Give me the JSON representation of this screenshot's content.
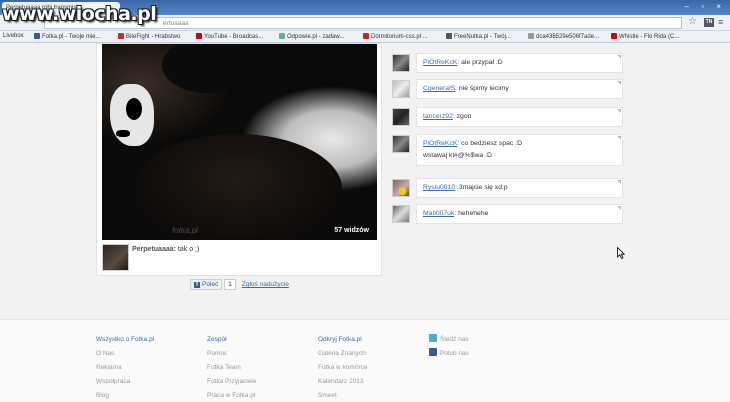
{
  "watermark": "www.wiocha.pl",
  "browser": {
    "tab_title": "Perpetuaaaa robi transmisj",
    "url_text": "ertuaaaa",
    "window_controls": "– ▫ ×",
    "ext_label": "TN",
    "bookmarks": [
      {
        "label": "Livebox",
        "icon_color": "#f60"
      },
      {
        "label": "Fotka.pl - Twoje mie...",
        "icon_color": "#3b5998"
      },
      {
        "label": "BiteFight - Hrabstwo",
        "icon_color": "#b33"
      },
      {
        "label": "YouTube - Broadcas...",
        "icon_color": "#d00"
      },
      {
        "label": "Odpowie.pl - zadaw...",
        "icon_color": "#6a9"
      },
      {
        "label": "Dormitorium-css.pl ...",
        "icon_color": "#c22"
      },
      {
        "label": "FreeNutka.pl - Twój...",
        "icon_color": "#555"
      },
      {
        "label": "dca438529e506f7ade...",
        "icon_color": "#999"
      },
      {
        "label": "Whistle - Flo Rida (C...",
        "icon_color": "#d00"
      }
    ]
  },
  "video": {
    "views": "57 widzów",
    "watermark": "fotka.pl"
  },
  "post": {
    "name": "Perpetuaaaa:",
    "text": "tak o ;)"
  },
  "share": {
    "fb_label": "Poleć",
    "count": "1",
    "report_label": "Zgłoś nadużycie"
  },
  "comments": [
    {
      "user": "PiOtReKcK",
      "text": "ale przypał :D",
      "line2": ""
    },
    {
      "user": "CgeneralS",
      "text": "nie śpimy lecimy",
      "line2": ""
    },
    {
      "user": "tancerz92",
      "text": "zgon",
      "line2": ""
    },
    {
      "user": "PiOtReKcK",
      "text": "co bedziesz spac :D",
      "line2": "wstawaj kl#@%$wa :D"
    },
    {
      "user": "Rysiu0810",
      "text": "3majcie się xd:p",
      "line2": ""
    },
    {
      "user": "Mati007uk",
      "text": "hehehehe",
      "line2": ""
    }
  ],
  "footer": {
    "columns": [
      {
        "heading": "Wszystko o Fotka.pl",
        "items": [
          "O Nas",
          "Reklama",
          "Współpraca",
          "Blog"
        ]
      },
      {
        "heading": "Zespół",
        "items": [
          "Pomoc",
          "Fotka Team",
          "Fotka Przyjaciele",
          "Praca w Fotka.pl"
        ]
      },
      {
        "heading": "Odkryj Fotka.pl",
        "items": [
          "Galeria Znanych",
          "Fotka w komórce",
          "Kalendarz 2013",
          "Smeet"
        ]
      },
      {
        "heading": "",
        "items": [
          "Śledź nas",
          "Polub nas"
        ]
      }
    ]
  }
}
